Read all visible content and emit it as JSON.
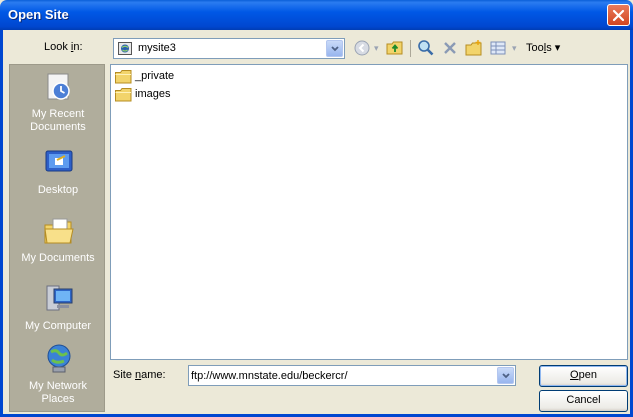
{
  "window": {
    "title": "Open Site"
  },
  "toolbar": {
    "look_in_label_pre": "Look ",
    "look_in_label_accel": "i",
    "look_in_label_post": "n:",
    "look_in_value": "mysite3",
    "tools_label_pre": "Too",
    "tools_label_accel": "l",
    "tools_label_post": "s ▾",
    "buttons": [
      "back-icon",
      "up-folder-icon",
      "search-web-icon",
      "delete-icon",
      "new-folder-icon",
      "views-icon"
    ]
  },
  "places_bar": {
    "items": [
      {
        "icon": "recent-documents-icon",
        "label_line1": "My Recent",
        "label_line2": "Documents"
      },
      {
        "icon": "desktop-icon",
        "label_line1": "Desktop",
        "label_line2": ""
      },
      {
        "icon": "my-documents-icon",
        "label_line1": "My Documents",
        "label_line2": ""
      },
      {
        "icon": "my-computer-icon",
        "label_line1": "My Computer",
        "label_line2": ""
      },
      {
        "icon": "my-network-places-icon",
        "label_line1": "My Network",
        "label_line2": "Places"
      }
    ]
  },
  "file_list": {
    "items": [
      {
        "name": "_private",
        "icon": "folder-icon"
      },
      {
        "name": "images",
        "icon": "folder-icon"
      }
    ]
  },
  "site_name": {
    "label_pre": "Site ",
    "label_accel": "n",
    "label_post": "ame:",
    "value": "ftp://www.mnstate.edu/beckercr/"
  },
  "buttons": {
    "open_accel": "O",
    "open_rest": "pen",
    "cancel": "Cancel"
  },
  "colors": {
    "titlebar": "#0058e6",
    "dialog_bg": "#ece9d8",
    "places_bg": "#b0ad9c",
    "close_button": "#d2451f"
  }
}
